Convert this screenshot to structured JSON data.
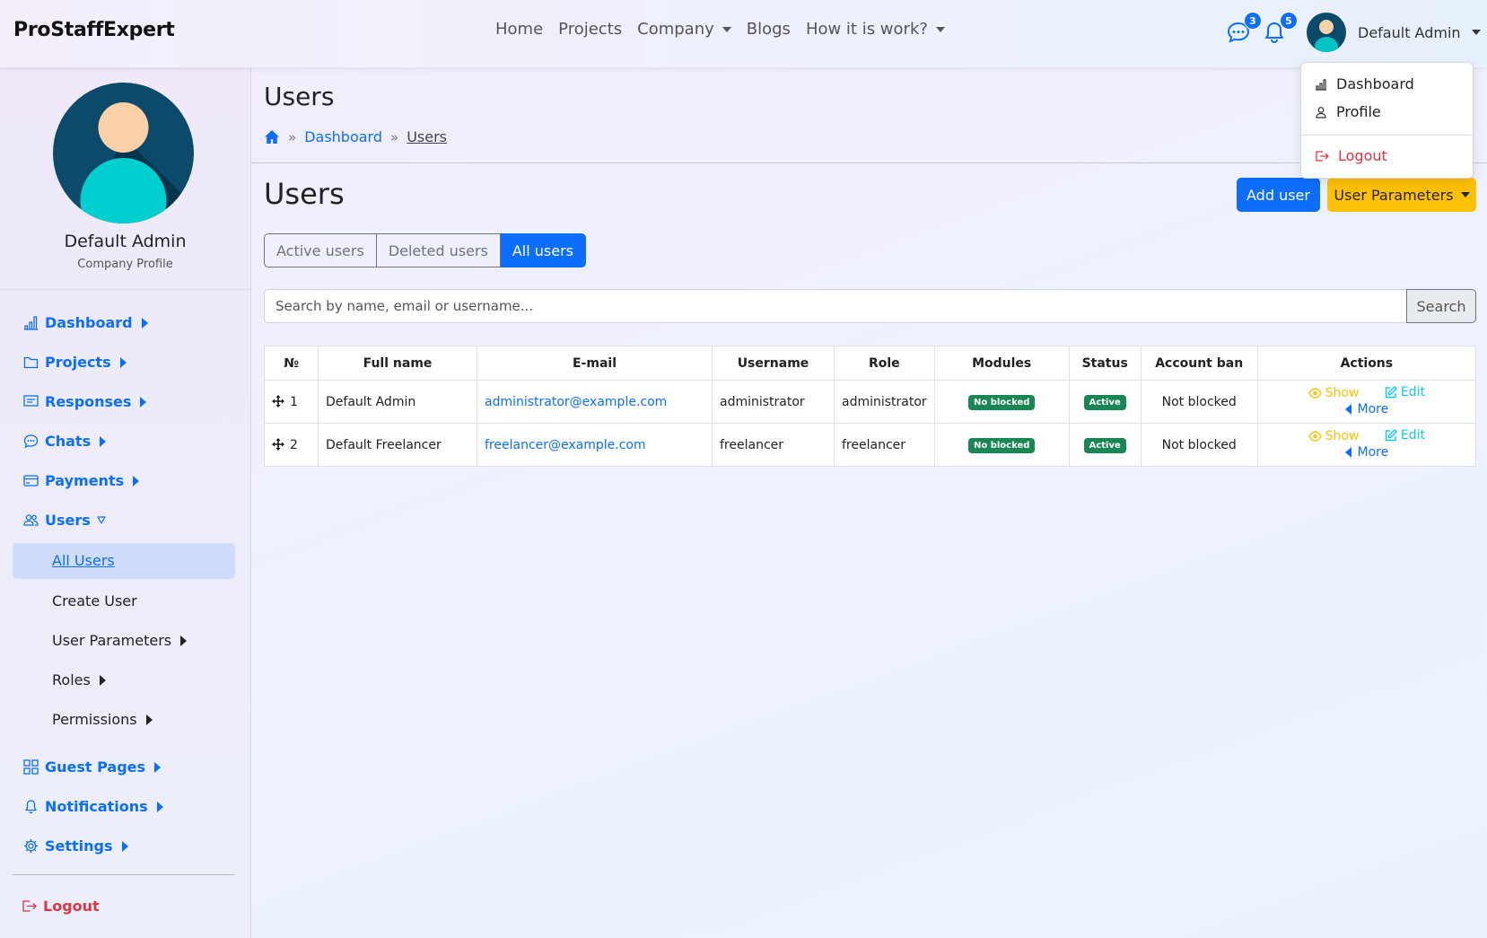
{
  "brand": "ProStaffExpert",
  "topnav": [
    {
      "label": "Home",
      "dropdown": false
    },
    {
      "label": "Projects",
      "dropdown": false
    },
    {
      "label": "Company",
      "dropdown": true
    },
    {
      "label": "Blogs",
      "dropdown": false
    },
    {
      "label": "How it is work?",
      "dropdown": true
    }
  ],
  "header": {
    "chat_count": "3",
    "notification_count": "5",
    "user_name": "Default Admin"
  },
  "user_dropdown": {
    "items": [
      "Dashboard",
      "Profile"
    ],
    "logout": "Logout"
  },
  "sidebar": {
    "profile_name": "Default Admin",
    "profile_subtitle": "Company Profile",
    "items": [
      {
        "label": "Dashboard",
        "icon": "bar-chart-icon"
      },
      {
        "label": "Projects",
        "icon": "folder-icon"
      },
      {
        "label": "Responses",
        "icon": "message-box-icon"
      },
      {
        "label": "Chats",
        "icon": "chat-icon"
      },
      {
        "label": "Payments",
        "icon": "credit-card-icon"
      },
      {
        "label": "Users",
        "icon": "people-icon"
      }
    ],
    "users_sub": [
      "All Users",
      "Create User",
      "User Parameters",
      "Roles",
      "Permissions"
    ],
    "items_bottom": [
      {
        "label": "Guest Pages",
        "icon": "grid-icon"
      },
      {
        "label": "Notifications",
        "icon": "bell-icon"
      },
      {
        "label": "Settings",
        "icon": "gear-icon"
      }
    ],
    "logout": "Logout"
  },
  "page": {
    "title": "Users",
    "breadcrumb": [
      "Dashboard",
      "Users"
    ],
    "section_title": "Users",
    "add_user": "Add user",
    "user_parameters": "User Parameters",
    "tabs": [
      "Active users",
      "Deleted users",
      "All users"
    ],
    "active_tab": "All users",
    "search_placeholder": "Search by name, email or username...",
    "search_button": "Search"
  },
  "table": {
    "headers": [
      "№",
      "Full name",
      "E-mail",
      "Username",
      "Role",
      "Modules",
      "Status",
      "Account ban",
      "Actions"
    ],
    "actions": [
      "Show",
      "Edit",
      "More"
    ],
    "rows": [
      {
        "num": "1",
        "full_name": "Default Admin",
        "email": "administrator@example.com",
        "username": "administrator",
        "role": "administrator",
        "modules": "No blocked",
        "status": "Active",
        "ban": "Not blocked"
      },
      {
        "num": "2",
        "full_name": "Default Freelancer",
        "email": "freelancer@example.com",
        "username": "freelancer",
        "role": "freelancer",
        "modules": "No blocked",
        "status": "Active",
        "ban": "Not blocked"
      }
    ]
  },
  "colors": {
    "primary": "#0d6efd",
    "warning": "#ffc107",
    "success": "#198754",
    "info": "#0dcaf0",
    "danger": "#dc3545"
  }
}
